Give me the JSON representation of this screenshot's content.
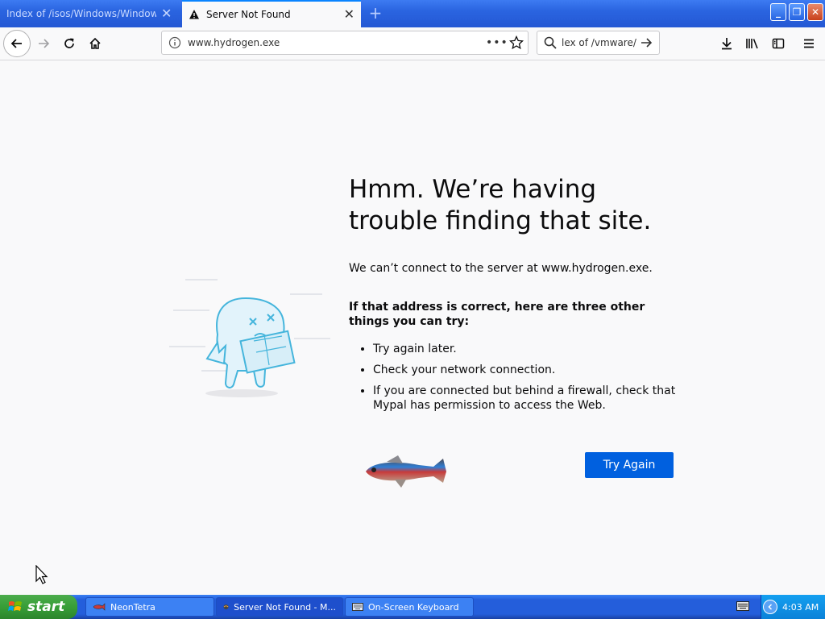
{
  "tabs": [
    {
      "label": "Index of /isos/Windows/Windows_Vist",
      "active": false
    },
    {
      "label": "Server Not Found",
      "active": true
    }
  ],
  "window_controls": {
    "minimize": "_",
    "maximize": "❐",
    "close": "✕"
  },
  "navbar": {
    "url": "www.hydrogen.exe",
    "page_actions": "•••",
    "search_value": "lex of /vmware/"
  },
  "error_page": {
    "title": "Hmm. We’re having trouble finding that site.",
    "description": "We can’t connect to the server at www.hydrogen.exe.",
    "suggestions_heading": "If that address is correct, here are three other things you can try:",
    "suggestions": [
      "Try again later.",
      "Check your network connection.",
      "If you are connected but behind a firewall, check that Mypal has permission to access the Web."
    ],
    "try_again_label": "Try Again"
  },
  "taskbar": {
    "start_label": "start",
    "items": [
      {
        "label": "NeonTetra"
      },
      {
        "label": "Server Not Found - M..."
      },
      {
        "label": "On-Screen Keyboard"
      }
    ],
    "clock": "4:03 AM"
  },
  "colors": {
    "accent": "#0060df",
    "tab_highlight": "#0a84ff",
    "taskbar_blue": "#245edb",
    "start_green": "#379e37"
  }
}
